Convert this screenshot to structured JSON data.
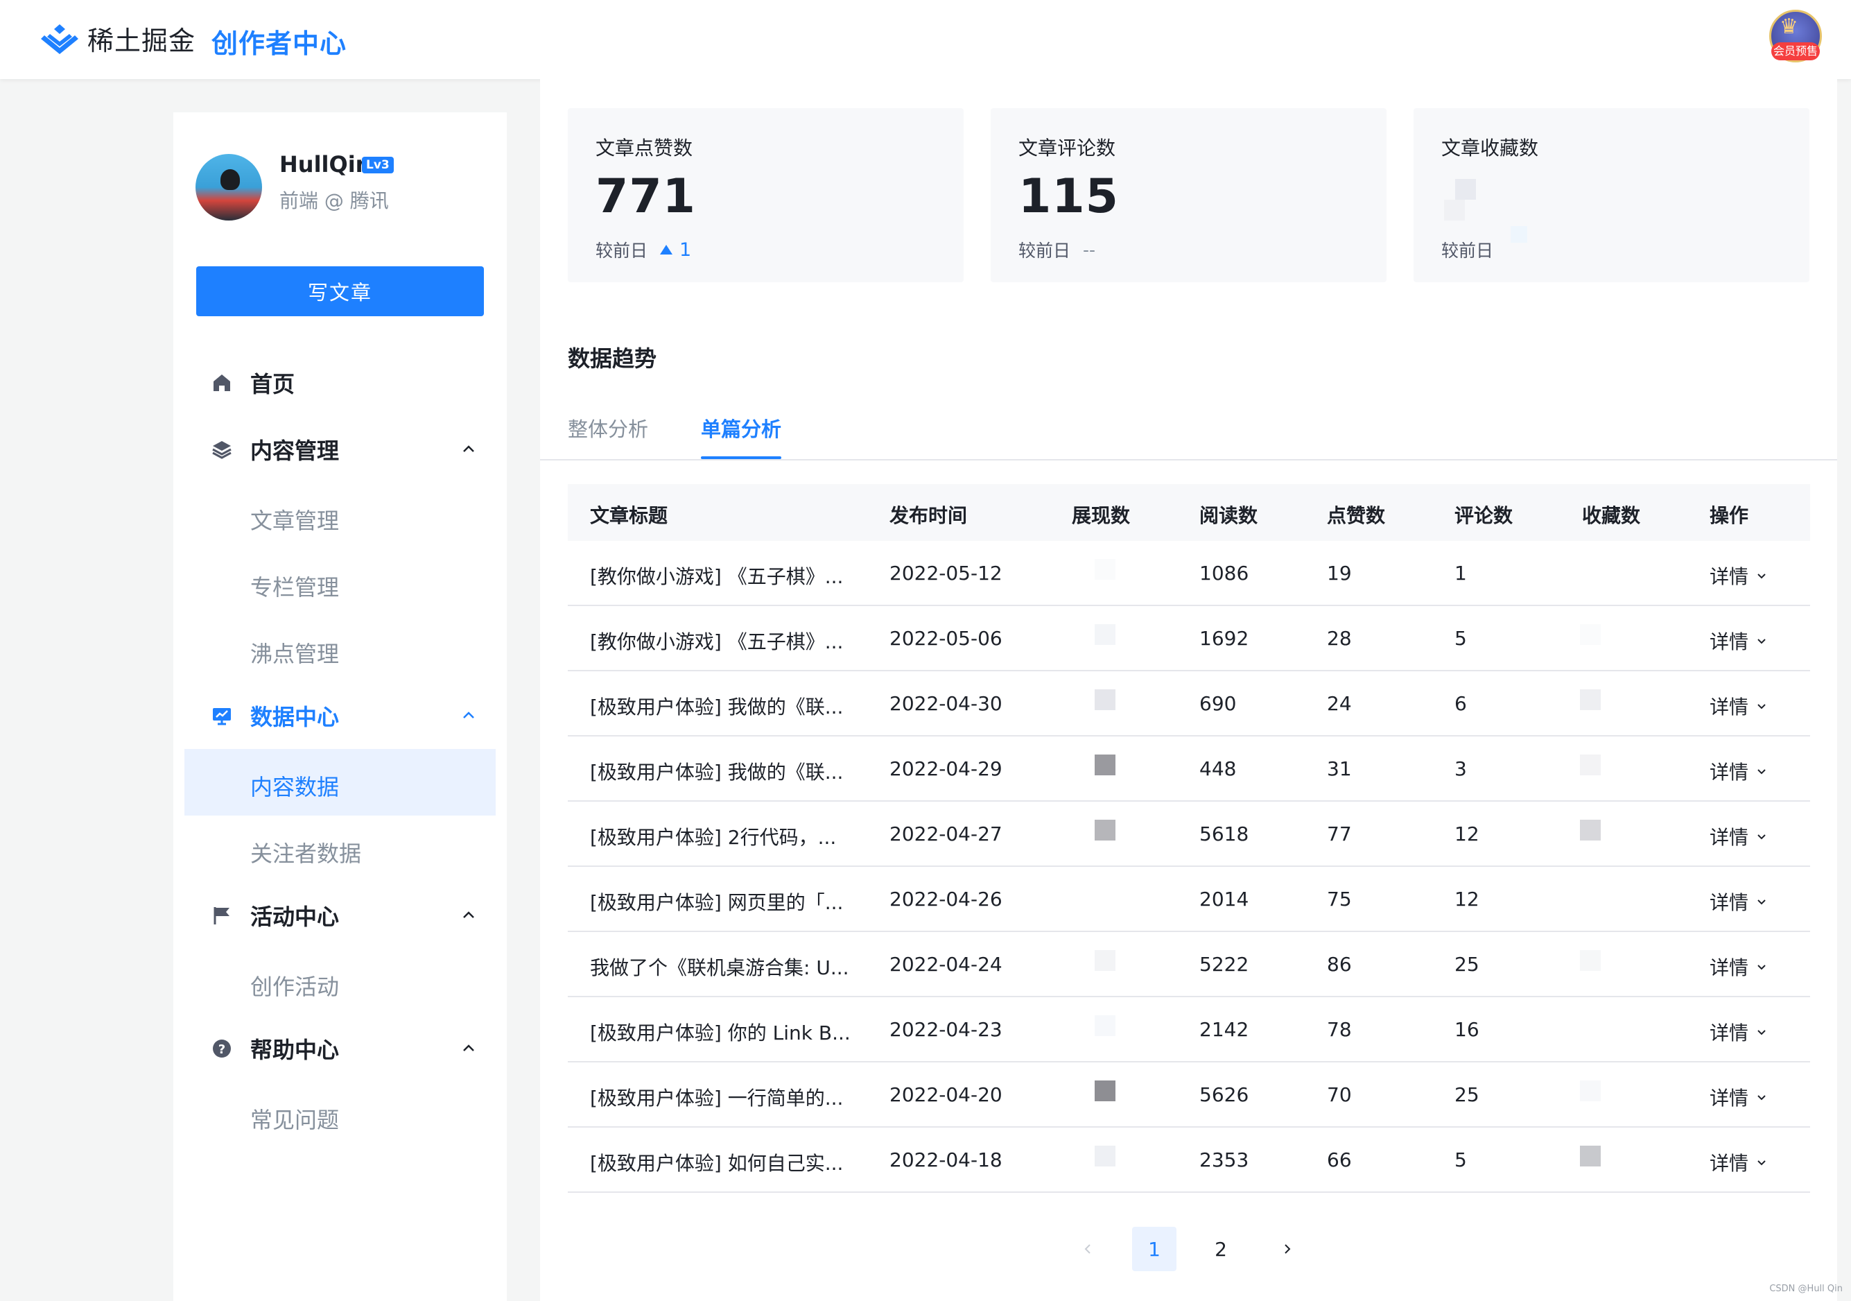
{
  "header": {
    "logo_text": "稀土掘金",
    "creator_title": "创作者中心",
    "vip_badge": "VIP",
    "vip_label": "会员预售"
  },
  "profile": {
    "username": "HullQin",
    "level": "Lv3",
    "title": "前端 @ 腾讯"
  },
  "write_button": "写文章",
  "nav": {
    "home": "首页",
    "content_mgmt": "内容管理",
    "content_sub": [
      "文章管理",
      "专栏管理",
      "沸点管理"
    ],
    "data_center": "数据中心",
    "data_sub": [
      "内容数据",
      "关注者数据"
    ],
    "activity_center": "活动中心",
    "activity_sub": [
      "创作活动"
    ],
    "help_center": "帮助中心",
    "help_sub": [
      "常见问题"
    ]
  },
  "stats": [
    {
      "title": "文章点赞数",
      "value": "771",
      "foot": "较前日",
      "delta": "1"
    },
    {
      "title": "文章评论数",
      "value": "115",
      "foot": "较前日",
      "delta": "--"
    },
    {
      "title": "文章收藏数",
      "value": "",
      "foot": "较前日",
      "delta": ""
    }
  ],
  "section_title": "数据趋势",
  "tabs": [
    "整体分析",
    "单篇分析"
  ],
  "table": {
    "headers": [
      "文章标题",
      "发布时间",
      "展现数",
      "阅读数",
      "点赞数",
      "评论数",
      "收藏数",
      "操作"
    ],
    "rows": [
      {
        "title": "[教你做小游戏] 《五子棋》...",
        "date": "2022-05-12",
        "reads": "1086",
        "likes": "19",
        "comments": "1",
        "action": "详情"
      },
      {
        "title": "[教你做小游戏] 《五子棋》...",
        "date": "2022-05-06",
        "reads": "1692",
        "likes": "28",
        "comments": "5",
        "action": "详情"
      },
      {
        "title": "[极致用户体验] 我做的《联...",
        "date": "2022-04-30",
        "reads": "690",
        "likes": "24",
        "comments": "6",
        "action": "详情"
      },
      {
        "title": "[极致用户体验] 我做的《联...",
        "date": "2022-04-29",
        "reads": "448",
        "likes": "31",
        "comments": "3",
        "action": "详情"
      },
      {
        "title": "[极致用户体验] 2行代码，...",
        "date": "2022-04-27",
        "reads": "5618",
        "likes": "77",
        "comments": "12",
        "action": "详情"
      },
      {
        "title": "[极致用户体验] 网页里的「...",
        "date": "2022-04-26",
        "reads": "2014",
        "likes": "75",
        "comments": "12",
        "action": "详情"
      },
      {
        "title": "我做了个《联机桌游合集: U...",
        "date": "2022-04-24",
        "reads": "5222",
        "likes": "86",
        "comments": "25",
        "action": "详情"
      },
      {
        "title": "[极致用户体验] 你的 Link B...",
        "date": "2022-04-23",
        "reads": "2142",
        "likes": "78",
        "comments": "16",
        "action": "详情"
      },
      {
        "title": "[极致用户体验] 一行简单的...",
        "date": "2022-04-20",
        "reads": "5626",
        "likes": "70",
        "comments": "25",
        "action": "详情"
      },
      {
        "title": "[极致用户体验] 如何自己实...",
        "date": "2022-04-18",
        "reads": "2353",
        "likes": "66",
        "comments": "5",
        "action": "详情"
      }
    ]
  },
  "pagination": {
    "pages": [
      "1",
      "2"
    ],
    "current": "1"
  },
  "watermark": "CSDN @Hull Qin",
  "colors": {
    "accent": "#1e80ff",
    "text": "#1d2129",
    "muted": "#86909c"
  }
}
